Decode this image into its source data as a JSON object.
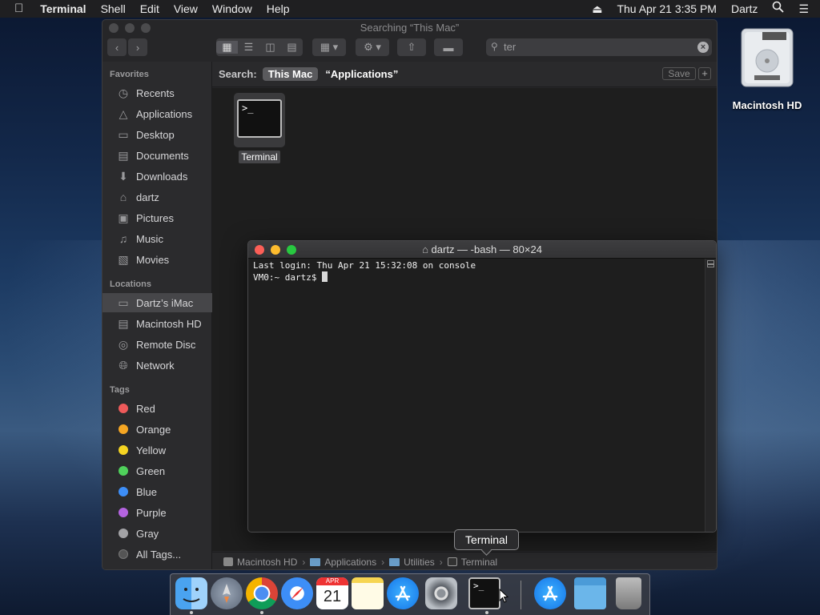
{
  "menubar": {
    "app_name": "Terminal",
    "items": [
      "Shell",
      "Edit",
      "View",
      "Window",
      "Help"
    ],
    "clock": "Thu Apr 21  3:35 PM",
    "user": "Dartz"
  },
  "desktop": {
    "hd_label": "Macintosh HD"
  },
  "finder": {
    "title": "Searching “This Mac”",
    "search_query": "ter",
    "scope": {
      "label": "Search:",
      "this_mac": "This Mac",
      "applications": "“Applications”",
      "save": "Save",
      "add": "+"
    },
    "sidebar": {
      "favorites_header": "Favorites",
      "favorites": [
        {
          "label": "Recents",
          "icon": "recents-icon"
        },
        {
          "label": "Applications",
          "icon": "applications-icon"
        },
        {
          "label": "Desktop",
          "icon": "desktop-icon"
        },
        {
          "label": "Documents",
          "icon": "documents-icon"
        },
        {
          "label": "Downloads",
          "icon": "downloads-icon"
        },
        {
          "label": "dartz",
          "icon": "home-icon"
        },
        {
          "label": "Pictures",
          "icon": "pictures-icon"
        },
        {
          "label": "Music",
          "icon": "music-icon"
        },
        {
          "label": "Movies",
          "icon": "movies-icon"
        }
      ],
      "locations_header": "Locations",
      "locations": [
        {
          "label": "Dartz’s iMac",
          "icon": "imac-icon"
        },
        {
          "label": "Macintosh HD",
          "icon": "disk-icon"
        },
        {
          "label": "Remote Disc",
          "icon": "disc-icon"
        },
        {
          "label": "Network",
          "icon": "network-icon"
        }
      ],
      "tags_header": "Tags",
      "tags": [
        {
          "label": "Red",
          "color": "#ee5a5a"
        },
        {
          "label": "Orange",
          "color": "#f5a623"
        },
        {
          "label": "Yellow",
          "color": "#f5d422"
        },
        {
          "label": "Green",
          "color": "#4fd15b"
        },
        {
          "label": "Blue",
          "color": "#3d8ef7"
        },
        {
          "label": "Purple",
          "color": "#b463e0"
        },
        {
          "label": "Gray",
          "color": "#a3a3a6"
        }
      ],
      "all_tags": "All Tags..."
    },
    "result": {
      "name": "Terminal"
    },
    "pathbar": [
      "Macintosh HD",
      "Applications",
      "Utilities",
      "Terminal"
    ]
  },
  "terminal": {
    "title": "dartz — -bash — 80×24",
    "line1": "Last login: Thu Apr 21 15:32:08 on console",
    "line2": "VM0:~ dartz$ "
  },
  "dock": {
    "tooltip": "Terminal",
    "calendar_month": "APR",
    "calendar_day": "21"
  }
}
